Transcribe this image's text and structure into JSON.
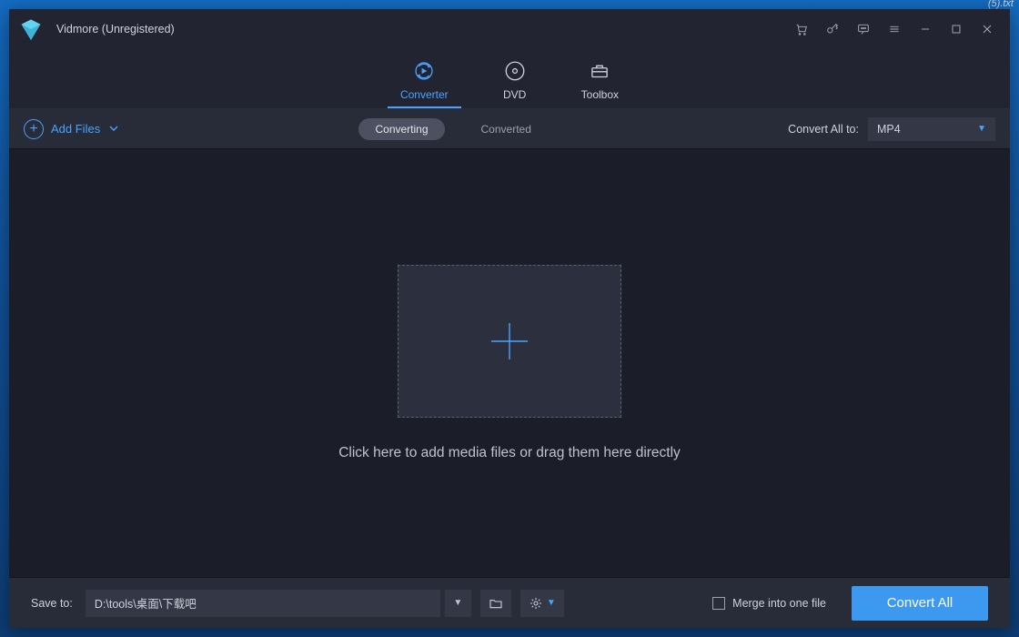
{
  "corner_text": "(5).txt",
  "titlebar": {
    "app_title": "Vidmore (Unregistered)"
  },
  "tabs": {
    "converter": "Converter",
    "dvd": "DVD",
    "toolbox": "Toolbox",
    "active": "converter"
  },
  "actionbar": {
    "add_files": "Add Files",
    "converting": "Converting",
    "converted": "Converted",
    "convert_all_to_label": "Convert All to:",
    "format_selected": "MP4"
  },
  "dropzone": {
    "hint": "Click here to add media files or drag them here directly"
  },
  "bottombar": {
    "save_to_label": "Save to:",
    "path_value": "D:\\tools\\桌面\\下载吧",
    "merge_label": "Merge into one file",
    "merge_checked": false,
    "convert_button": "Convert All"
  }
}
